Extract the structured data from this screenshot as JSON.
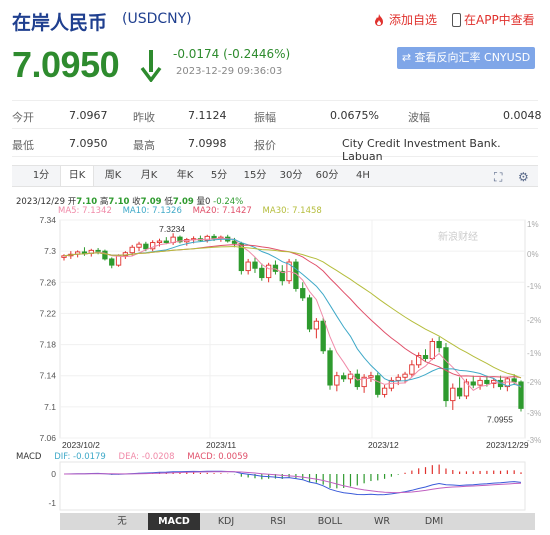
{
  "header": {
    "title": "在岸人民币",
    "code": "(USDCNY)",
    "favorite_label": "添加自选",
    "app_label": "在APP中查看"
  },
  "quote": {
    "price": "7.0950",
    "change": "-0.0174 (-0.2446%)",
    "datetime": "2023-12-29 09:36:03",
    "reverse_button": "查看反向汇率 CNYUSD"
  },
  "stats": {
    "row1": [
      {
        "label": "今开",
        "value": "7.0967"
      },
      {
        "label": "昨收",
        "value": "7.1124"
      },
      {
        "label": "振幅",
        "value": "0.0675%"
      },
      {
        "label": "波幅",
        "value": "0.0048"
      }
    ],
    "row2": [
      {
        "label": "最低",
        "value": "7.0950"
      },
      {
        "label": "最高",
        "value": "7.0998"
      },
      {
        "label": "报价",
        "value": "City Credit Investment Bank. Labuan"
      }
    ]
  },
  "tabs": [
    "1分",
    "日K",
    "周K",
    "月K",
    "年K",
    "5分",
    "15分",
    "30分",
    "60分",
    "4H"
  ],
  "active_tab": "日K",
  "ohlc": {
    "date": "2023/12/29",
    "open_label": "开",
    "open": "7.10",
    "high_label": "高",
    "high": "7.10",
    "close_label": "收",
    "close": "7.09",
    "low_label": "低",
    "low": "7.09",
    "vol_label": "量",
    "vol": "0",
    "pct": "-0.24%"
  },
  "ma": {
    "ma5": "MA5: 7.1342",
    "ma10": "MA10: 7.1326",
    "ma20": "MA20: 7.1427",
    "ma30": "MA30: 7.1458"
  },
  "macd": {
    "name": "MACD",
    "dif": "DIF: -0.0179",
    "dea": "DEA: -0.0208",
    "macd": "MACD: 0.0059"
  },
  "indicator_tabs": [
    "无",
    "MACD",
    "KDJ",
    "RSI",
    "BOLL",
    "WR",
    "DMI"
  ],
  "active_indicator": "MACD",
  "watermark": "新浪财经",
  "colors": {
    "up": "#e0322e",
    "down": "#2e9a2e",
    "ma5": "#f08aa8",
    "ma10": "#3fa9c8",
    "ma20": "#e0506a",
    "ma30": "#b5bd3c",
    "title": "#1f3f8f",
    "button": "#7fa6e8"
  },
  "chart_data": {
    "type": "candlestick",
    "y_ticks": [
      "7.34",
      "7.3",
      "7.26",
      "7.22",
      "7.18",
      "7.14",
      "7.1",
      "7.06"
    ],
    "y_pct_ticks": [
      "1%",
      "0%",
      "-1%",
      "-2%",
      "-3%",
      "-2%",
      "-3%"
    ],
    "y_pct_ticks_right": [
      "1%",
      "0%",
      "-1%",
      "-2%",
      "-1%",
      "-2%",
      "-3%",
      "-3%"
    ],
    "x_labels": [
      "2023/10/2",
      "2023/11",
      "2023/12",
      "2023/12/29"
    ],
    "ylim": [
      7.06,
      7.34
    ],
    "annotations": [
      {
        "label": "7.3234",
        "value": 7.3234
      },
      {
        "label": "7.0955",
        "value": 7.0955
      }
    ],
    "macd_ticks": [
      "0",
      "-1"
    ],
    "candles": [
      [
        7.292,
        7.296,
        7.288,
        7.294
      ],
      [
        7.294,
        7.3,
        7.29,
        7.296
      ],
      [
        7.296,
        7.301,
        7.292,
        7.299
      ],
      [
        7.299,
        7.305,
        7.294,
        7.297
      ],
      [
        7.297,
        7.303,
        7.293,
        7.301
      ],
      [
        7.301,
        7.304,
        7.296,
        7.3
      ],
      [
        7.3,
        7.302,
        7.288,
        7.29
      ],
      [
        7.29,
        7.292,
        7.278,
        7.282
      ],
      [
        7.282,
        7.296,
        7.28,
        7.294
      ],
      [
        7.294,
        7.3,
        7.29,
        7.298
      ],
      [
        7.298,
        7.308,
        7.294,
        7.305
      ],
      [
        7.305,
        7.312,
        7.3,
        7.309
      ],
      [
        7.309,
        7.312,
        7.3,
        7.303
      ],
      [
        7.303,
        7.314,
        7.3,
        7.311
      ],
      [
        7.311,
        7.316,
        7.306,
        7.313
      ],
      [
        7.313,
        7.318,
        7.309,
        7.311
      ],
      [
        7.311,
        7.323,
        7.308,
        7.318
      ],
      [
        7.318,
        7.32,
        7.31,
        7.312
      ],
      [
        7.312,
        7.317,
        7.307,
        7.315
      ],
      [
        7.315,
        7.319,
        7.31,
        7.316
      ],
      [
        7.316,
        7.32,
        7.312,
        7.314
      ],
      [
        7.314,
        7.321,
        7.311,
        7.319
      ],
      [
        7.319,
        7.322,
        7.313,
        7.316
      ],
      [
        7.316,
        7.32,
        7.312,
        7.318
      ],
      [
        7.318,
        7.321,
        7.311,
        7.313
      ],
      [
        7.313,
        7.317,
        7.305,
        7.31
      ],
      [
        7.31,
        7.312,
        7.27,
        7.275
      ],
      [
        7.275,
        7.29,
        7.27,
        7.286
      ],
      [
        7.286,
        7.292,
        7.272,
        7.278
      ],
      [
        7.278,
        7.284,
        7.262,
        7.266
      ],
      [
        7.266,
        7.285,
        7.26,
        7.282
      ],
      [
        7.282,
        7.288,
        7.27,
        7.274
      ],
      [
        7.274,
        7.282,
        7.256,
        7.262
      ],
      [
        7.262,
        7.29,
        7.258,
        7.286
      ],
      [
        7.286,
        7.29,
        7.248,
        7.252
      ],
      [
        7.252,
        7.26,
        7.236,
        7.24
      ],
      [
        7.24,
        7.244,
        7.196,
        7.2
      ],
      [
        7.2,
        7.214,
        7.188,
        7.21
      ],
      [
        7.21,
        7.214,
        7.168,
        7.172
      ],
      [
        7.172,
        7.176,
        7.122,
        7.128
      ],
      [
        7.128,
        7.145,
        7.12,
        7.14
      ],
      [
        7.14,
        7.144,
        7.132,
        7.136
      ],
      [
        7.136,
        7.146,
        7.13,
        7.142
      ],
      [
        7.142,
        7.148,
        7.122,
        7.126
      ],
      [
        7.126,
        7.142,
        7.118,
        7.138
      ],
      [
        7.138,
        7.145,
        7.132,
        7.14
      ],
      [
        7.14,
        7.144,
        7.112,
        7.116
      ],
      [
        7.116,
        7.128,
        7.112,
        7.124
      ],
      [
        7.124,
        7.138,
        7.12,
        7.134
      ],
      [
        7.134,
        7.142,
        7.128,
        7.138
      ],
      [
        7.138,
        7.145,
        7.13,
        7.142
      ],
      [
        7.142,
        7.16,
        7.138,
        7.154
      ],
      [
        7.154,
        7.17,
        7.15,
        7.166
      ],
      [
        7.166,
        7.174,
        7.158,
        7.162
      ],
      [
        7.162,
        7.188,
        7.16,
        7.184
      ],
      [
        7.184,
        7.19,
        7.17,
        7.176
      ],
      [
        7.176,
        7.182,
        7.1,
        7.108
      ],
      [
        7.108,
        7.13,
        7.096,
        7.124
      ],
      [
        7.124,
        7.138,
        7.11,
        7.114
      ],
      [
        7.114,
        7.136,
        7.11,
        7.132
      ],
      [
        7.132,
        7.14,
        7.124,
        7.128
      ],
      [
        7.128,
        7.138,
        7.122,
        7.134
      ],
      [
        7.134,
        7.14,
        7.126,
        7.13
      ],
      [
        7.13,
        7.137,
        7.124,
        7.134
      ],
      [
        7.134,
        7.14,
        7.122,
        7.126
      ],
      [
        7.126,
        7.138,
        7.12,
        7.136
      ],
      [
        7.136,
        7.142,
        7.128,
        7.132
      ],
      [
        7.132,
        7.134,
        7.094,
        7.098
      ]
    ]
  }
}
